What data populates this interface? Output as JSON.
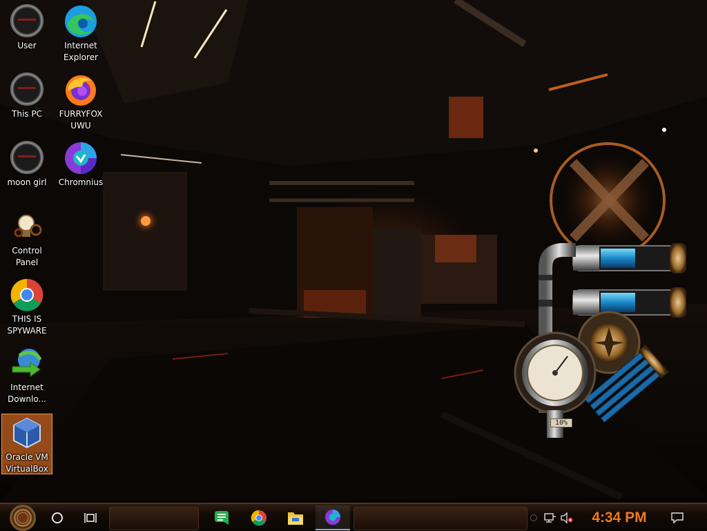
{
  "desktop": {
    "icons": [
      {
        "label": "User",
        "icon": "gauge-user-icon"
      },
      {
        "label": "Internet Explorer",
        "icon": "edge-browser-icon"
      },
      {
        "label": "This PC",
        "icon": "gauge-this-pc-icon"
      },
      {
        "label": "FURRYFOX UWU",
        "icon": "firefox-icon"
      },
      {
        "label": "moon girl",
        "icon": "gauge-moon-girl-icon"
      },
      {
        "label": "Chromnius",
        "icon": "chromnius-icon"
      },
      {
        "label": "Control Panel",
        "icon": "lightbulb-gear-icon"
      },
      {
        "label": "THIS IS SPYWARE",
        "icon": "chrome-icon"
      },
      {
        "label": "Internet Downlo...",
        "icon": "internet-download-manager-icon"
      },
      {
        "label": "Oracle VM VirtualBox",
        "icon": "virtualbox-icon",
        "selected": true
      }
    ]
  },
  "widget": {
    "gauge_percent_label": "10%",
    "gauge_value": 0.1,
    "top_tube_fill": 0.5,
    "middle_tube_fill": 0.5
  },
  "taskbar": {
    "start_icon": "steampunk-gear-start-icon",
    "search_icon": "cortana-circle-icon",
    "taskview_icon": "task-view-icon",
    "pinned": [
      {
        "name": "green-chat-app-icon",
        "active": false
      },
      {
        "name": "chrome-icon",
        "active": false
      },
      {
        "name": "file-explorer-icon",
        "active": false
      },
      {
        "name": "chromnius-icon",
        "active": true
      }
    ],
    "tray": {
      "network_icon": "network-icon",
      "volume_icon": "volume-muted-icon",
      "time": "4:34 PM",
      "notification_icon": "notification-icon"
    }
  },
  "colors": {
    "clock": "#ee7a1a",
    "selection": "#c46220",
    "taskbar_border": "#5a3216"
  }
}
